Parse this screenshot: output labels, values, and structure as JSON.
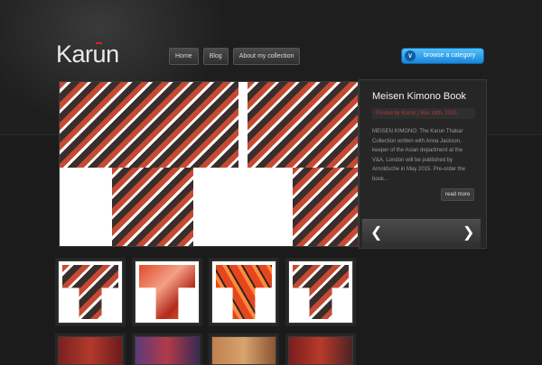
{
  "site": {
    "logo_text_pre": "Kar",
    "logo_text_u": "u",
    "logo_text_post": "n"
  },
  "nav": [
    {
      "label": "Home"
    },
    {
      "label": "Blog"
    },
    {
      "label": "About my collection"
    }
  ],
  "browse_button": {
    "label": "browse a category",
    "icon": "chevron-down-icon"
  },
  "featured": {
    "title": "Meisen Kimono Book",
    "posted": "Posted by Karun | Mar 18th, 2015",
    "excerpt": "MEISEN KIMONO: The Karun Thakar Collection written with Anna Jackson, keeper of the Asian department at the V&A, London will be published by Arnoldsche in May 2015. Pre-order the book...",
    "read_more": "read more",
    "prev_icon": "chevron-left-icon",
    "next_icon": "chevron-right-icon"
  },
  "colors": {
    "accent_blue": "#2a9aec",
    "brand_red": "#d0271c",
    "posted_red": "#b03a3a"
  }
}
